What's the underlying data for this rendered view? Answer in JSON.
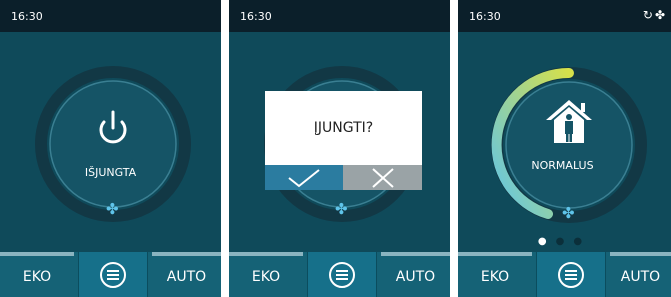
{
  "screens": [
    {
      "time": "16:30",
      "center_label": "IŠJUNGTA",
      "center_icon": "power-icon",
      "fan_icon": "fan-icon",
      "buttons": {
        "left": "EKO",
        "center_icon": "menu-icon",
        "right": "AUTO"
      }
    },
    {
      "time": "16:30",
      "dialog": {
        "title": "ĮJUNGTI?",
        "confirm_icon": "checkmark-icon",
        "cancel_icon": "close-icon"
      },
      "fan_icon": "fan-icon",
      "buttons": {
        "left": "EKO",
        "center_icon": "menu-icon",
        "right": "AUTO"
      }
    },
    {
      "time": "16:30",
      "status_icons": [
        "sync-icon",
        "fan-settings-icon"
      ],
      "center_label": "NORMALUS",
      "center_icon": "home-person-icon",
      "fan_icon": "fan-icon",
      "page_indicator": {
        "count": 3,
        "active": 1
      },
      "buttons": {
        "left": "EKO",
        "center_icon": "menu-icon",
        "right": "AUTO"
      }
    }
  ],
  "colors": {
    "background": "#0f4a5a",
    "statusbar": "#0b1f2a",
    "bottombar": "#156276",
    "accent_blue": "#2b7ca0",
    "gradient_start": "#5fc4ea",
    "gradient_end": "#d6e04a"
  }
}
